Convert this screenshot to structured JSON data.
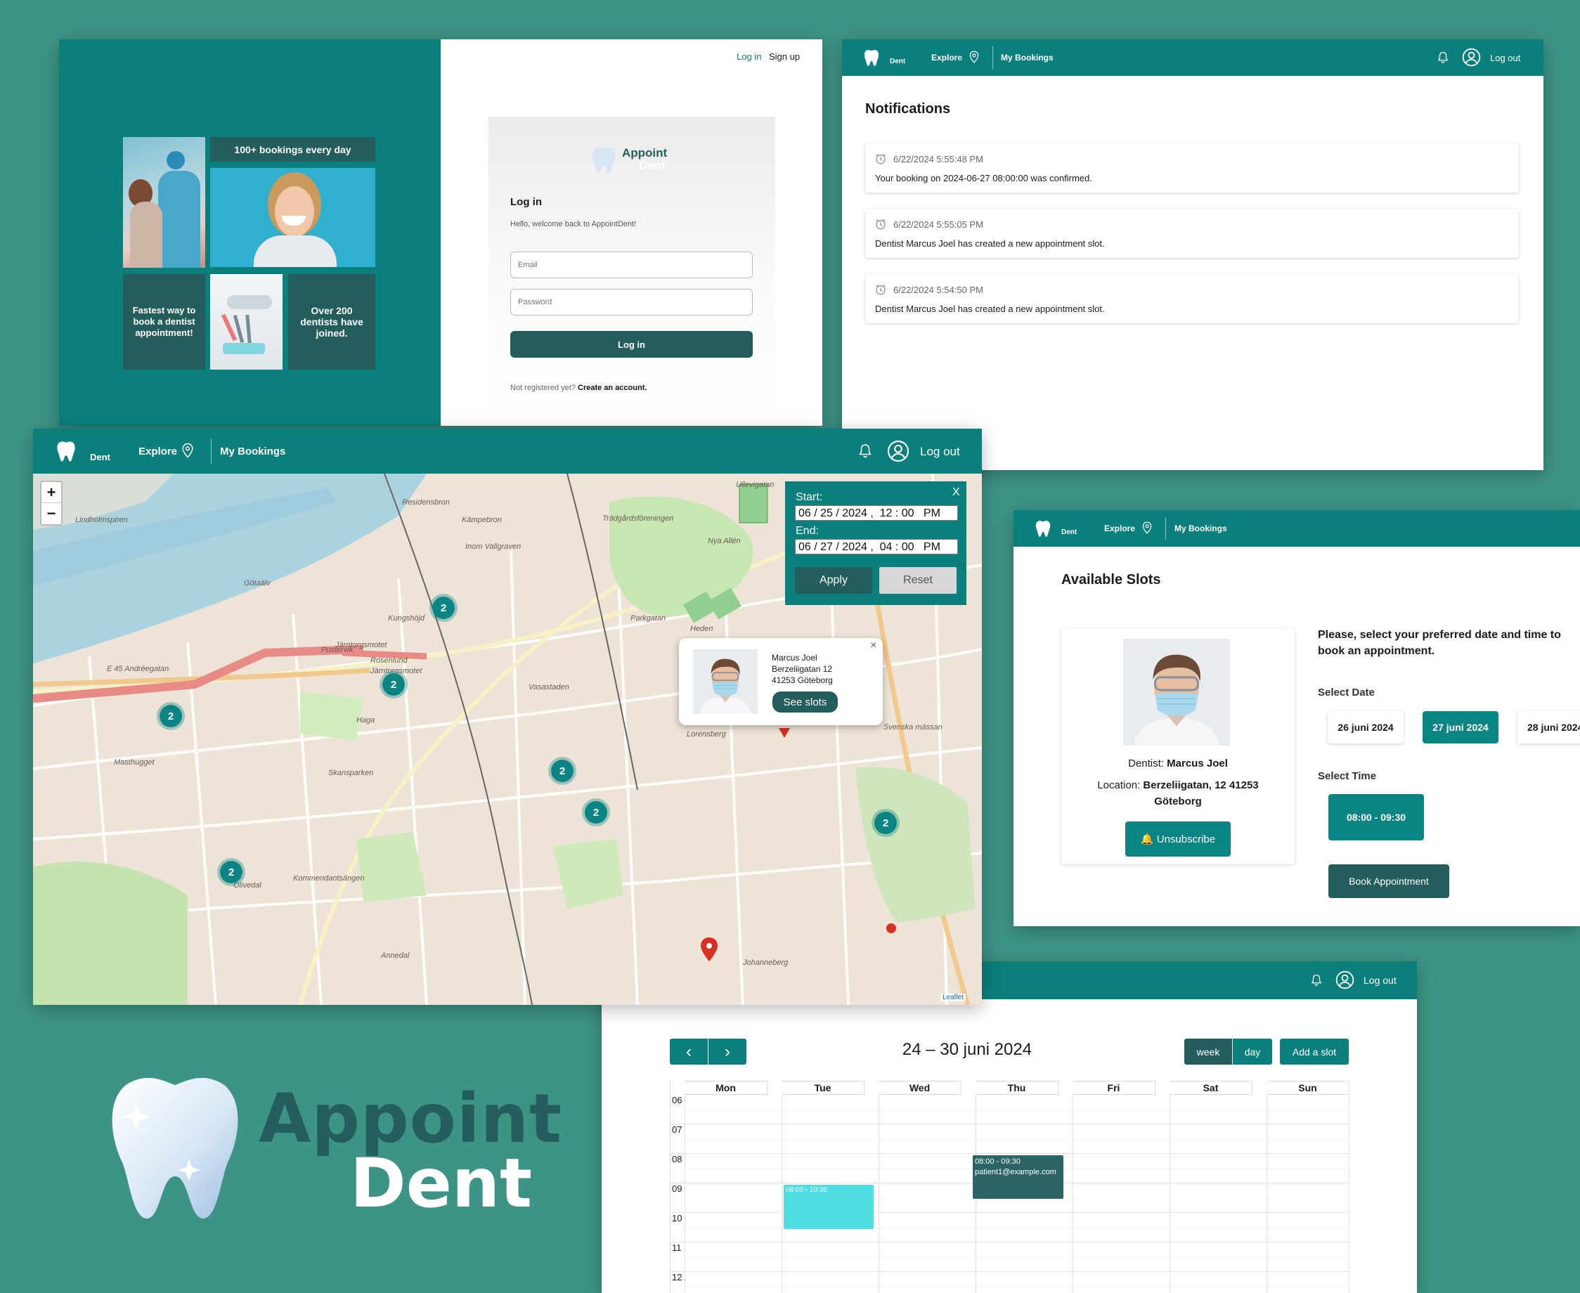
{
  "login": {
    "top_login": "Log in",
    "top_signup": "Sign up",
    "tile_bookings": "100+ bookings every day",
    "tile_fastest": "Fastest way to book a dentist appointment!",
    "tile_dentists": "Over 200 dentists have joined.",
    "logo_appoint": "Appoint",
    "logo_dent": "Dent",
    "heading": "Log in",
    "welcome": "Hello, welcome back to AppointDent!",
    "email_placeholder": "Email",
    "password_placeholder": "Password",
    "submit": "Log in",
    "not_registered": "Not registered yet?",
    "create_account": "Create an account."
  },
  "nav": {
    "logo_small": "Appoint",
    "logo_dent": "Dent",
    "explore": "Explore",
    "bookings": "My Bookings",
    "logout": "Log out"
  },
  "notifications": {
    "title": "Notifications",
    "items": [
      {
        "time": "6/22/2024 5:55:48 PM",
        "text": "Your booking on 2024-06-27 08:00:00 was confirmed."
      },
      {
        "time": "6/22/2024 5:55:05 PM",
        "text": "Dentist Marcus Joel has created a new appointment slot."
      },
      {
        "time": "6/22/2024 5:54:50 PM",
        "text": "Dentist Marcus Joel has created a new appointment slot."
      }
    ]
  },
  "map": {
    "zoom_in": "+",
    "zoom_out": "−",
    "filter": {
      "close": "X",
      "start_label": "Start:",
      "start_value": "06 / 25 / 2024 ,  12 : 00   PM",
      "end_label": "End:",
      "end_value": "06 / 27 / 2024 ,  04 : 00   PM",
      "apply": "Apply",
      "reset": "Reset"
    },
    "popup": {
      "close": "×",
      "name": "Marcus Joel",
      "street": "Berzeliigatan 12",
      "city": "41253 Göteborg",
      "button": "See slots"
    },
    "clusters": [
      "2",
      "2",
      "2",
      "2",
      "2",
      "2",
      "2"
    ],
    "place_labels": [
      "Residensbron",
      "Kämpebron",
      "Inom Vallgraven",
      "Trädgårdsföreningen",
      "Kungshöjd",
      "Rosenlund",
      "Järntorgsmotet",
      "Pustervik",
      "Järntorgsmotet",
      "Haga",
      "Vasastaden",
      "Heden",
      "Lorensberg",
      "Svenska mässan",
      "Masthugget",
      "Skansparken",
      "Olivedal",
      "Kommendantsängen",
      "Annedal",
      "Johanneberg",
      "Ullevigatan",
      "Nya Allén",
      "Parkgatan",
      "Götaälv",
      "Lindholmspiren",
      "E 45  Andréegatan"
    ],
    "attribution": "Leaflet"
  },
  "slots": {
    "title": "Available Slots",
    "prompt": "Please, select your preferred date and time to book an appointment.",
    "dentist_label": "Dentist:",
    "dentist_name": "Marcus Joel",
    "location_label": "Location:",
    "location_value": "Berzeliigatan, 12 41253 Göteborg",
    "unsubscribe": "🔔 Unsubscribe",
    "select_date": "Select Date",
    "dates": [
      "26 juni 2024",
      "27 juni 2024",
      "28 juni 2024"
    ],
    "select_time": "Select Time",
    "time": "08:00 - 09:30",
    "book": "Book Appointment"
  },
  "calendar": {
    "logout": "Log out",
    "range": "24 – 30 juni 2024",
    "prev": "‹",
    "next": "›",
    "week": "week",
    "day": "day",
    "add": "Add a slot",
    "days": [
      "Mon",
      "Tue",
      "Wed",
      "Thu",
      "Fri",
      "Sat",
      "Sun"
    ],
    "hours": [
      "06",
      "07",
      "08",
      "09",
      "10",
      "11",
      "12"
    ],
    "event_tue": "08:00 - 10:30",
    "event_thu_time": "08:00 - 09:30",
    "event_thu_email": "patient1@example.com"
  },
  "brand": {
    "appoint": "Appoint",
    "dent": "Dent"
  },
  "colors": {
    "teal": "#0b7f7c",
    "dark_teal": "#235e5c",
    "background": "#3d9486",
    "cyan_event": "#4ddde3"
  }
}
